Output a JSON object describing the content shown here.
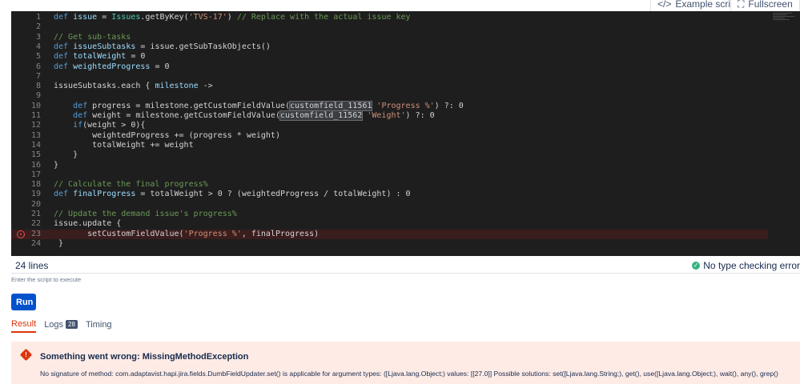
{
  "toolbar": {
    "example_scripts": "Example scripts",
    "fullscreen": "Fullscreen"
  },
  "editor": {
    "lines": [
      {
        "n": "1",
        "html": "<span class='kw'>def</span> <span class='fn'>issue</span> = <span class='cls'>Issues</span>.getByKey(<span class='str'>'TVS-17'</span>) <span class='cm'>// Replace with the actual issue key</span>"
      },
      {
        "n": "2",
        "html": ""
      },
      {
        "n": "3",
        "html": "<span class='cm'>// Get sub-tasks</span>"
      },
      {
        "n": "4",
        "html": "<span class='kw'>def</span> <span class='fn'>issueSubtasks</span> = issue.getSubTaskObjects()"
      },
      {
        "n": "5",
        "html": "<span class='kw'>def</span> <span class='fn'>totalWeight</span> = 0"
      },
      {
        "n": "6",
        "html": "<span class='kw'>def</span> <span class='fn'>weightedProgress</span> = 0"
      },
      {
        "n": "7",
        "html": ""
      },
      {
        "n": "8",
        "html": "issueSubtasks.each { <span class='fn'>milestone</span> ->"
      },
      {
        "n": "9",
        "html": ""
      },
      {
        "n": "10",
        "html": "    <span class='kw'>def</span> progress = milestone.getCustomFieldValue(<span class='hl'>customfield_11561</span> <span class='str'>'Progress %'</span>) ?: 0"
      },
      {
        "n": "11",
        "html": "    <span class='kw'>def</span> weight = milestone.getCustomFieldValue(<span class='hl'>customfield_11562</span> <span class='str'>'Weight'</span>) ?: 0"
      },
      {
        "n": "12",
        "html": "    <span class='kw'>if</span>(weight > 0){"
      },
      {
        "n": "13",
        "html": "        weightedProgress += (progress * weight)"
      },
      {
        "n": "14",
        "html": "        totalWeight += weight"
      },
      {
        "n": "15",
        "html": "    }"
      },
      {
        "n": "16",
        "html": "}"
      },
      {
        "n": "17",
        "html": ""
      },
      {
        "n": "18",
        "html": "<span class='cm'>// Calculate the final progress%</span>"
      },
      {
        "n": "19",
        "html": "<span class='kw'>def</span> <span class='fn'>finalProgress</span> = totalWeight > 0 ? (weightedProgress / totalWeight) : 0"
      },
      {
        "n": "20",
        "html": ""
      },
      {
        "n": "21",
        "html": "<span class='cm'>// Update the demand issue's progress%</span>"
      },
      {
        "n": "22",
        "html": "issue.update {"
      },
      {
        "n": "23",
        "html": "       setCustomFieldValue(<span class='str'>'Progress %'</span>, finalProgress)",
        "error": true
      },
      {
        "n": "24",
        "html": " }"
      }
    ]
  },
  "status": {
    "line_count": "24 lines",
    "type_check": "No type checking error"
  },
  "hint": "Enter the script to execute",
  "run_label": "Run",
  "tabs": [
    {
      "label": "Result",
      "active": true
    },
    {
      "label": "Logs",
      "badge": "28"
    },
    {
      "label": "Timing"
    }
  ],
  "error": {
    "title": "Something went wrong: MissingMethodException",
    "message": "No signature of method: com.adaptavist.hapi.jira.fields.DumbFieldUpdater.set() is applicable for argument types: ([Ljava.lang.Object;) values: [[27.0]] Possible solutions: set([Ljava.lang.String;), get(), use([Ljava.lang.Object;), wait(), any(), grep()"
  }
}
